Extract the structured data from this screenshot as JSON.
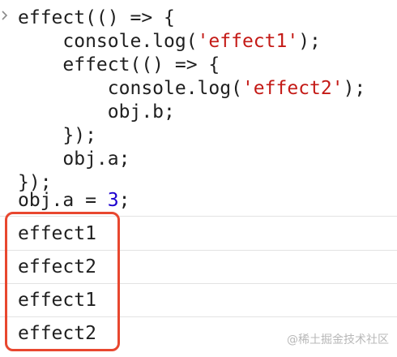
{
  "input": {
    "line1": {
      "code": "effect(() => {"
    },
    "line2": {
      "pre": "    console.log(",
      "str": "'effect1'",
      "post": ");"
    },
    "line3": {
      "code": "    effect(() => {"
    },
    "line4": {
      "pre": "        console.log(",
      "str": "'effect2'",
      "post": ");"
    },
    "line5": {
      "code": "        obj.b;"
    },
    "line6": {
      "code": "    });"
    },
    "line7": {
      "code": "    obj.a;"
    },
    "line8": {
      "code": "});"
    },
    "line9": {
      "pre": "obj.a = ",
      "num": "3",
      "post": ";"
    }
  },
  "output": [
    {
      "text": "effect1"
    },
    {
      "text": "effect2"
    },
    {
      "text": "effect1"
    },
    {
      "text": "effect2"
    }
  ],
  "watermark": "@稀土掘金技术社区",
  "colors": {
    "string": "#c41a16",
    "number": "#1c00cf",
    "highlight_border": "#e8472f"
  }
}
